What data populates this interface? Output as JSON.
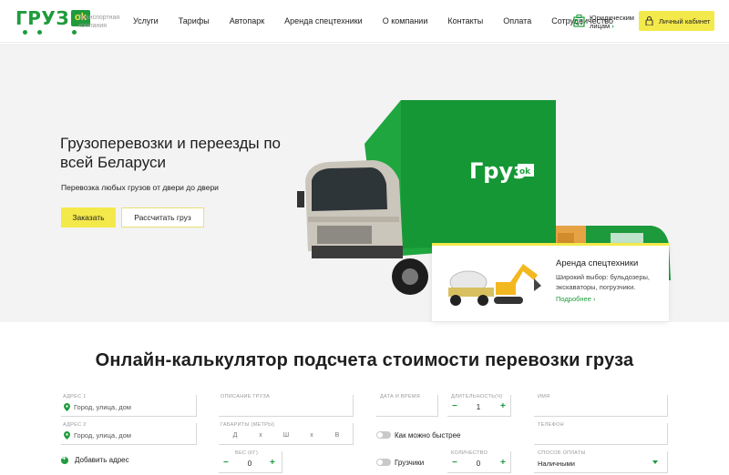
{
  "header": {
    "logo_word": "ГРУЗ",
    "logo_badge": "ok",
    "logo_subtitle": "Транспортная компания",
    "nav": [
      "Услуги",
      "Тарифы",
      "Автопарк",
      "Аренда спецтехники",
      "О компании",
      "Контакты",
      "Оплата",
      "Сотрудничество"
    ],
    "legal_label": "Юридическим лицам",
    "legal_arrow": "›",
    "cabinet_label": "Личный кабинет"
  },
  "hero": {
    "title": "Грузоперевозки и переезды по всей Беларуси",
    "subtitle": "Перевозка любых грузов от двери до двери",
    "order_label": "Заказать",
    "calc_label": "Рассчитать груз",
    "truck_logo_word": "Груз",
    "truck_logo_badge": "ok"
  },
  "promo": {
    "title": "Аренда спецтехники",
    "description": "Широкий выбор: бульдозеры, экскаваторы, погрузчики.",
    "more": "Подробнее ›"
  },
  "calculator": {
    "title": "Онлайн-калькулятор подсчета стоимости перевозки груза",
    "address1_label": "адрес 1",
    "address1_placeholder": "Город, улица, дом",
    "address2_label": "адрес 2",
    "address2_placeholder": "Город, улица, дом",
    "add_address": "Добавить адрес",
    "description_label": "описание груза",
    "dimensions_label": "габариты (метры)",
    "dimensions": [
      "Д",
      "х",
      "Ш",
      "х",
      "В"
    ],
    "weight_label": "вес (кг)",
    "weight_minus": "−",
    "weight_value": "0",
    "weight_plus": "+",
    "datetime_label": "дата и время",
    "duration_label": "длительность(ч)",
    "duration_minus": "−",
    "duration_value": "1",
    "duration_plus": "+",
    "fastest_label": "Как можно быстрее",
    "loaders_label": "Грузчики",
    "quantity_label": "количество",
    "quantity_minus": "−",
    "quantity_value": "0",
    "quantity_plus": "+",
    "name_label": "имя",
    "phone_label": "телефон",
    "payment_label": "способ оплаты",
    "payment_value": "Наличными"
  },
  "colors": {
    "brand_green": "#1f9b3c",
    "accent_yellow": "#f4e94a",
    "hero_bg": "#f3f3f3"
  }
}
